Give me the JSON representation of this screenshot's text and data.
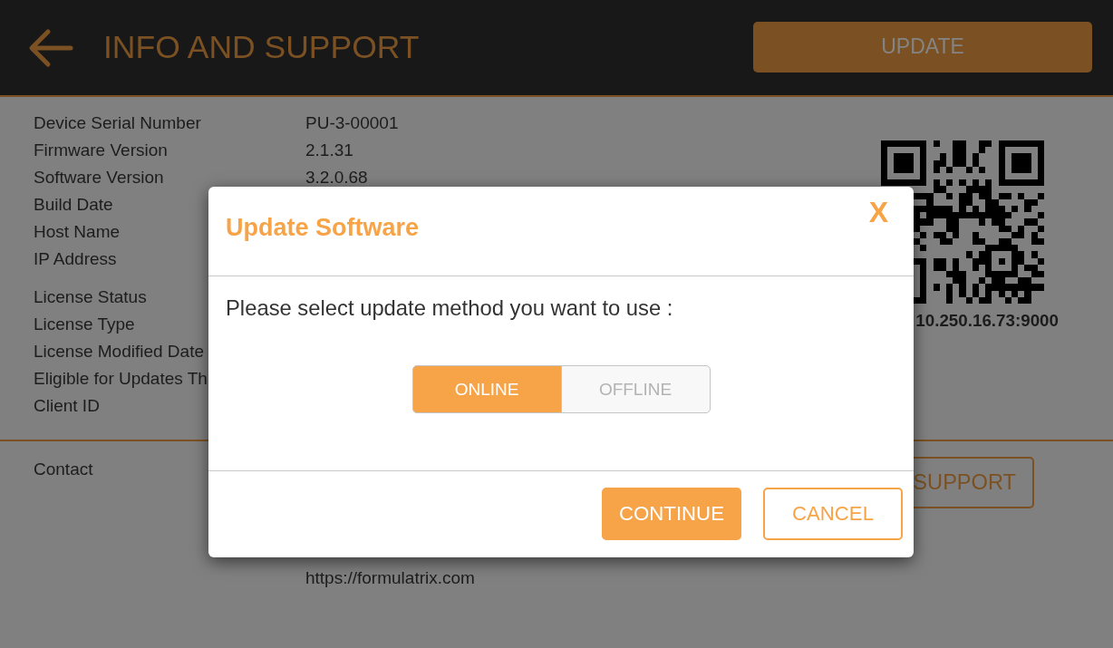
{
  "header": {
    "title": "INFO AND SUPPORT",
    "update_button": "UPDATE"
  },
  "device_info": [
    {
      "label": "Device Serial Number",
      "value": "PU-3-00001"
    },
    {
      "label": "Firmware Version",
      "value": "2.1.31"
    },
    {
      "label": "Software Version",
      "value": "3.2.0.68"
    },
    {
      "label": "Build Date"
    },
    {
      "label": "Host Name"
    },
    {
      "label": "IP Address"
    }
  ],
  "license_info": [
    {
      "label": "License Status"
    },
    {
      "label": "License Type"
    },
    {
      "label": "License Modified Date"
    },
    {
      "label": "Eligible for Updates Th"
    },
    {
      "label": "Client ID"
    }
  ],
  "qr": {
    "address": "10.250.16.73:9000"
  },
  "contact": {
    "label": "Contact",
    "lines": [
      "https://formulatrix.com"
    ],
    "support_button": "SUPPORT"
  },
  "dialog": {
    "title": "Update Software",
    "close": "X",
    "message": "Please select update method you want to use :",
    "methods": [
      {
        "label": "ONLINE",
        "selected": true
      },
      {
        "label": "OFFLINE",
        "selected": false
      }
    ],
    "buttons": [
      {
        "label": "CONTINUE",
        "kind": "primary"
      },
      {
        "label": "CANCEL",
        "kind": "secondary"
      }
    ]
  }
}
